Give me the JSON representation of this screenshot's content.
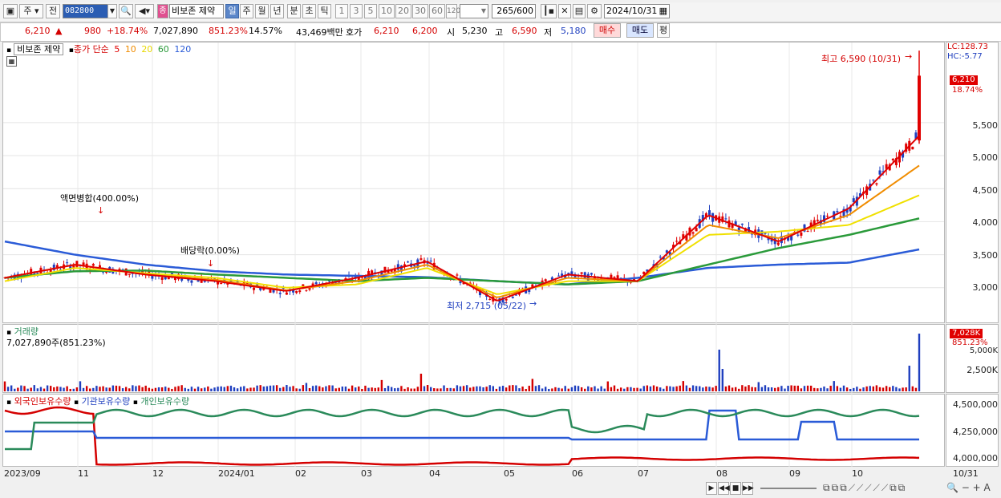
{
  "toolbar": {
    "market": "주",
    "prev": "전",
    "code": "082800",
    "name_badge": "종",
    "name": "비보존 제약",
    "periods": [
      "일",
      "주",
      "월",
      "년",
      "분",
      "초",
      "틱"
    ],
    "active_period": "일",
    "intervals": [
      "1",
      "3",
      "5",
      "10",
      "20",
      "30",
      "60",
      "120"
    ],
    "count": "265",
    "count_total": "/600",
    "date": "2024/10/31"
  },
  "quote": {
    "price": "6,210",
    "arrow": "▲",
    "change": "980",
    "change_pct": "+18.74%",
    "volume": "7,027,890",
    "volume_ratio": "851.23%",
    "turnover": "14.57%",
    "amount": "43,469백만",
    "bid_label": "호가",
    "ask": "6,210",
    "bid": "6,200",
    "open_label": "시",
    "open": "5,230",
    "high_label": "고",
    "high": "6,590",
    "low_label": "저",
    "low": "5,180",
    "buy": "매수",
    "sell": "매도",
    "eval": "평"
  },
  "price_panel": {
    "title": "비보존 제약",
    "ma_label": "종가 단순",
    "ma_periods": [
      "5",
      "10",
      "20",
      "60",
      "120"
    ],
    "ma_colors": [
      "#e00000",
      "#f08c00",
      "#f0e000",
      "#2a9a3a",
      "#2a5bd7"
    ],
    "high_note": "최고 6,590 (10/31)",
    "low_note": "최저 2,715 (05/22)",
    "event1": "액면병합(400.00%)",
    "event2": "배당락(0.00%)",
    "lc": "LC:128.73",
    "hc": "HC:-5.77",
    "last_price_tag": "6,210",
    "last_pct_tag": "18.74%",
    "y_ticks": [
      "5,500",
      "5,000",
      "4,500",
      "4,000",
      "3,500",
      "3,000"
    ]
  },
  "volume_panel": {
    "title": "거래량",
    "value": "7,027,890주(851.23%)",
    "tag": "7,028K",
    "tag_pct": "851.23%",
    "y_ticks": [
      "5,000K",
      "2,500K"
    ]
  },
  "holdings_panel": {
    "foreign": "외국인보유수량",
    "inst": "기관보유수량",
    "indiv": "개인보유수량",
    "y_ticks": [
      "4,500,000",
      "4,250,000",
      "4,000,000"
    ]
  },
  "x_axis": [
    "2023/09",
    "11",
    "12",
    "2024/01",
    "02",
    "03",
    "04",
    "05",
    "06",
    "07",
    "08",
    "09",
    "10"
  ],
  "x_axis_end": "10/31",
  "chart_data": {
    "type": "line",
    "title": "비보존 제약",
    "x": [
      "2023/09",
      "11",
      "12",
      "2024/01",
      "02",
      "03",
      "04",
      "05",
      "06",
      "07",
      "08",
      "09",
      "10",
      "10/31"
    ],
    "series": [
      {
        "name": "5",
        "values": [
          3150,
          3350,
          3200,
          3100,
          2950,
          3150,
          3400,
          2800,
          3200,
          3100,
          4100,
          3700,
          4200,
          5300
        ]
      },
      {
        "name": "10",
        "values": [
          3150,
          3350,
          3200,
          3120,
          2960,
          3100,
          3350,
          2850,
          3150,
          3100,
          3950,
          3750,
          4100,
          4850
        ]
      },
      {
        "name": "20",
        "values": [
          3100,
          3300,
          3220,
          3150,
          3000,
          3050,
          3300,
          2900,
          3100,
          3100,
          3800,
          3850,
          3950,
          4400
        ]
      },
      {
        "name": "60",
        "values": [
          3150,
          3250,
          3260,
          3200,
          3150,
          3100,
          3150,
          3100,
          3050,
          3100,
          3350,
          3600,
          3800,
          4050
        ]
      },
      {
        "name": "120",
        "values": [
          3700,
          3500,
          3350,
          3250,
          3200,
          3180,
          3160,
          3100,
          3050,
          3150,
          3300,
          3350,
          3380,
          3580
        ]
      }
    ],
    "ylim": [
      2500,
      6700
    ]
  }
}
